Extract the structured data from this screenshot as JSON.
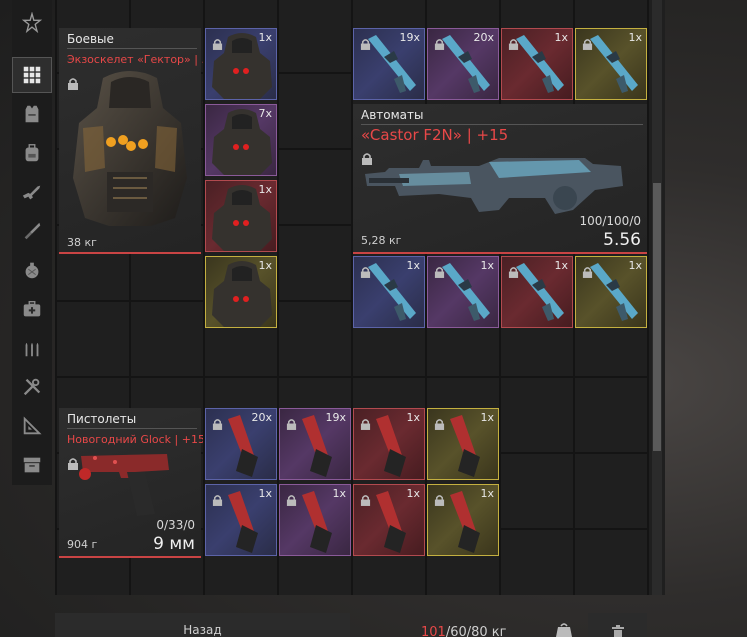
{
  "sidebar": {
    "items": [
      {
        "icon": "star-emblem-icon"
      },
      {
        "icon": "grid-icon",
        "active": true
      },
      {
        "icon": "vest-icon"
      },
      {
        "icon": "backpack-icon"
      },
      {
        "icon": "rifle-icon"
      },
      {
        "icon": "knife-icon"
      },
      {
        "icon": "grenade-icon"
      },
      {
        "icon": "medkit-icon"
      },
      {
        "icon": "ammo-icon"
      },
      {
        "icon": "tools-icon"
      },
      {
        "icon": "ruler-triangle-icon"
      },
      {
        "icon": "storage-box-icon"
      }
    ]
  },
  "categories": {
    "combat": {
      "title": "Боевые",
      "item": "Экзоскелет «Гектор» | ..",
      "weight": "38 кг"
    },
    "rifles": {
      "title": "Автоматы",
      "item": "«Castor F2N» | +15",
      "weight": "5,28 кг",
      "ammo": "100/100/0",
      "caliber": "5.56"
    },
    "pistols": {
      "title": "Пистолеты",
      "item": "Новогодний Glock | +15",
      "weight": "904 г",
      "ammo": "0/33/0",
      "caliber": "9 мм"
    }
  },
  "tiles": {
    "armor": [
      {
        "count": "1x",
        "rarity": "blue"
      },
      {
        "count": "7x",
        "rarity": "purple"
      },
      {
        "count": "1x",
        "rarity": "red"
      },
      {
        "count": "1x",
        "rarity": "gold"
      }
    ],
    "rifle_top": [
      {
        "count": "19x",
        "rarity": "blue"
      },
      {
        "count": "20x",
        "rarity": "purple"
      },
      {
        "count": "1x",
        "rarity": "red"
      },
      {
        "count": "1x",
        "rarity": "gold"
      }
    ],
    "rifle_bottom": [
      {
        "count": "1x",
        "rarity": "blue"
      },
      {
        "count": "1x",
        "rarity": "purple"
      },
      {
        "count": "1x",
        "rarity": "red"
      },
      {
        "count": "1x",
        "rarity": "gold"
      }
    ],
    "pistol_top": [
      {
        "count": "20x",
        "rarity": "blue"
      },
      {
        "count": "19x",
        "rarity": "purple"
      },
      {
        "count": "1x",
        "rarity": "red"
      },
      {
        "count": "1x",
        "rarity": "gold"
      }
    ],
    "pistol_bottom": [
      {
        "count": "1x",
        "rarity": "blue"
      },
      {
        "count": "1x",
        "rarity": "purple"
      },
      {
        "count": "1x",
        "rarity": "red"
      },
      {
        "count": "1x",
        "rarity": "gold"
      }
    ]
  },
  "bottom": {
    "back_label": "Назад",
    "weight_current": "101",
    "weight_rest": "/60/80 кг"
  },
  "colors": {
    "accent_red": "#e84848",
    "rarity_blue": "#5c63a8",
    "rarity_purple": "#8a5a99",
    "rarity_red": "#b24a4f",
    "rarity_gold": "#c4b040"
  }
}
